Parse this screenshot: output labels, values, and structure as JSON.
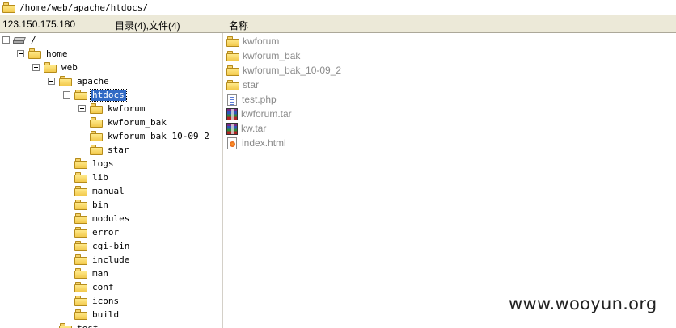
{
  "path_bar": {
    "path": "/home/web/apache/htdocs/"
  },
  "header": {
    "ip": "123.150.175.180",
    "counts": "目录(4),文件(4)",
    "column_name": "名称"
  },
  "tree": {
    "root": "/",
    "home": "home",
    "web": "web",
    "apache": "apache",
    "htdocs": "htdocs",
    "htdocs_children": [
      "kwforum",
      "kwforum_bak",
      "kwforum_bak_10-09_2",
      "star"
    ],
    "apache_children": [
      "logs",
      "lib",
      "manual",
      "bin",
      "modules",
      "error",
      "cgi-bin",
      "include",
      "man",
      "conf",
      "icons",
      "build"
    ],
    "cut_off_item": "test"
  },
  "files": [
    {
      "name": "kwforum",
      "icon": "folder-icon"
    },
    {
      "name": "kwforum_bak",
      "icon": "folder-icon"
    },
    {
      "name": "kwforum_bak_10-09_2",
      "icon": "folder-icon"
    },
    {
      "name": "star",
      "icon": "folder-icon"
    },
    {
      "name": "test.php",
      "icon": "php-file-icon"
    },
    {
      "name": "kwforum.tar",
      "icon": "archive-icon"
    },
    {
      "name": "kw.tar",
      "icon": "archive-icon"
    },
    {
      "name": "index.html",
      "icon": "html-file-icon"
    }
  ],
  "watermark": "www.wooyun.org",
  "colors": {
    "selection": "#316ac5",
    "header_bg": "#ece9d8",
    "file_text": "#8a8a8a",
    "folder": "#f5d36a"
  }
}
